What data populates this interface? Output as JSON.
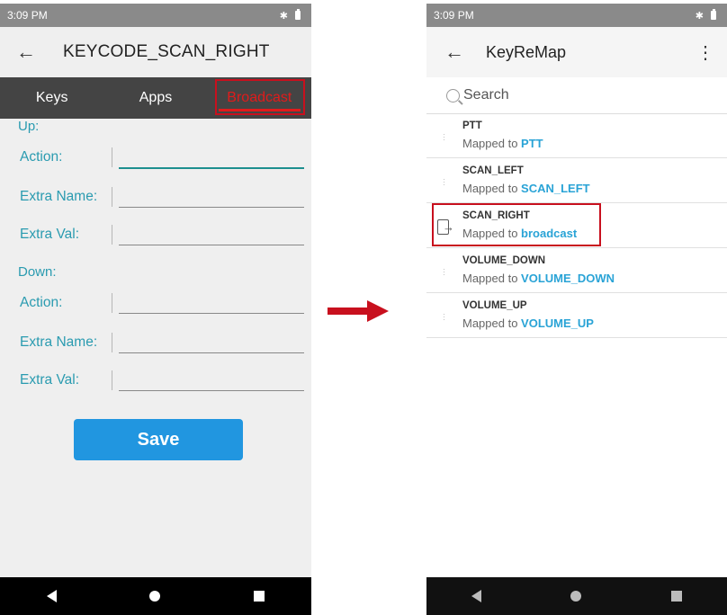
{
  "left_screen": {
    "status_time": "3:09 PM",
    "status_icons": "✱",
    "title": "KEYCODE_SCAN_RIGHT",
    "back_glyph": "←",
    "tabs": [
      {
        "label": "Keys"
      },
      {
        "label": "Apps"
      },
      {
        "label": "Broadcast"
      }
    ],
    "active_tab": "Broadcast",
    "up_section": "Up:",
    "down_section": "Down:",
    "fields": {
      "action_label": "Action:",
      "extra_name_label": "Extra Name:",
      "extra_val_label": "Extra Val:"
    },
    "save_label": "Save"
  },
  "right_screen": {
    "status_time": "3:09 PM",
    "status_icons": "✱",
    "back_glyph": "←",
    "title": "KeyReMap",
    "menu_glyph": "⋮",
    "search_placeholder": "Search",
    "items": [
      {
        "name": "PTT",
        "mapped_prefix": "Mapped to ",
        "mapped_value": "PTT"
      },
      {
        "name": "SCAN_LEFT",
        "mapped_prefix": "Mapped to ",
        "mapped_value": "SCAN_LEFT"
      },
      {
        "name": "SCAN_RIGHT",
        "mapped_prefix": "Mapped to ",
        "mapped_value": "broadcast"
      },
      {
        "name": "VOLUME_DOWN",
        "mapped_prefix": "Mapped to ",
        "mapped_value": "VOLUME_DOWN"
      },
      {
        "name": "VOLUME_UP",
        "mapped_prefix": "Mapped to ",
        "mapped_value": "VOLUME_UP"
      }
    ]
  },
  "colors": {
    "accent_red": "#e11b1b",
    "label_teal": "#2a9bb0",
    "button_blue": "#2196e0",
    "mapped_blue": "#29a3d6",
    "tab_bar": "#444444"
  }
}
